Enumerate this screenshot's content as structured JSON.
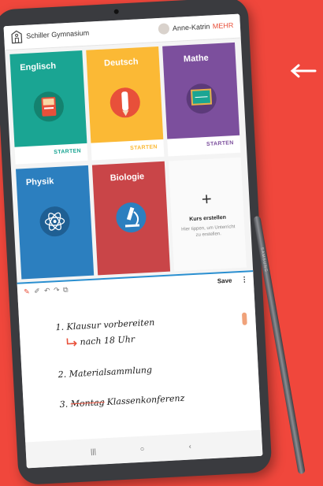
{
  "app": {
    "school_name": "Schiller Gymnasium",
    "user_name": "Anne-Katrin",
    "more_label": "MEHR"
  },
  "courses": [
    {
      "name": "Englisch",
      "start_label": "STARTEN",
      "icon": "book-icon",
      "color": "#1aa593"
    },
    {
      "name": "Deutsch",
      "start_label": "STARTEN",
      "icon": "pencil-icon",
      "color": "#fbb935"
    },
    {
      "name": "Mathe",
      "start_label": "STARTEN",
      "icon": "chalkboard-icon",
      "color": "#7c4f9d"
    },
    {
      "name": "Physik",
      "start_label": "",
      "icon": "atom-icon",
      "color": "#2c7fbf"
    },
    {
      "name": "Biologie",
      "start_label": "",
      "icon": "microscope-icon",
      "color": "#c94548"
    }
  ],
  "add_course": {
    "title": "Kurs erstellen",
    "hint": "Hier tippen, um Unterricht zu erstellen."
  },
  "notes_toolbar": {
    "save_label": "Save",
    "more_icon": "⋮"
  },
  "notes": {
    "line1": "1. Klausur vorbereiten",
    "line1_sub": "nach 18 Uhr",
    "line2": "2. Materialsammlung",
    "line3_struck": "Montag",
    "line3_prefix": "3.",
    "line3_rest": "Klassenkonferenz"
  },
  "device": {
    "pen_brand": "SAMSUNG"
  }
}
